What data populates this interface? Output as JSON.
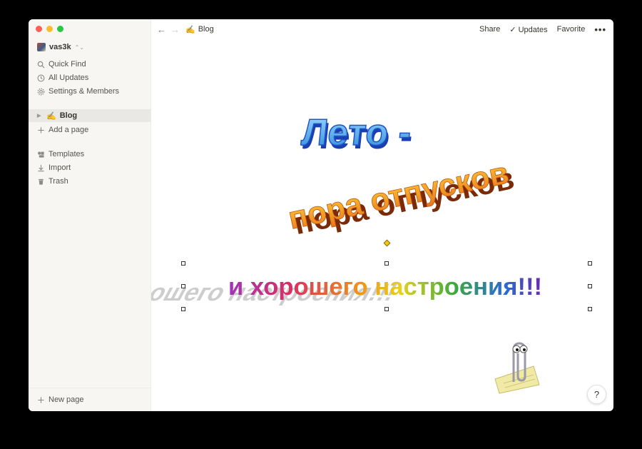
{
  "workspace": {
    "name": "vas3k"
  },
  "sidebar": {
    "top_items": [
      {
        "label": "Quick Find",
        "icon": "search-icon"
      },
      {
        "label": "All Updates",
        "icon": "clock-icon"
      },
      {
        "label": "Settings & Members",
        "icon": "gear-icon"
      }
    ],
    "pages": [
      {
        "label": "Blog",
        "emoji": "✍️"
      }
    ],
    "add_page": "Add a page",
    "bottom_items": [
      {
        "label": "Templates",
        "icon": "templates-icon"
      },
      {
        "label": "Import",
        "icon": "import-icon"
      },
      {
        "label": "Trash",
        "icon": "trash-icon"
      }
    ],
    "new_page": "New page"
  },
  "topbar": {
    "breadcrumb_emoji": "✍️",
    "breadcrumb": "Blog",
    "share": "Share",
    "updates": "Updates",
    "favorite": "Favorite",
    "more": "•••"
  },
  "content": {
    "wordart_line1": "Лето -",
    "wordart_line2": "пора отпусков",
    "wordart_line3": "и хорошего настроения!!!",
    "assistant_icon": "clippy-paperclip-icon"
  },
  "help": "?",
  "colors": {
    "sidebar_bg": "#f7f6f3",
    "active_item_bg": "#e9e8e4",
    "wordart_blue": "#3aa0e8",
    "wordart_orange": "#f08a1c"
  }
}
